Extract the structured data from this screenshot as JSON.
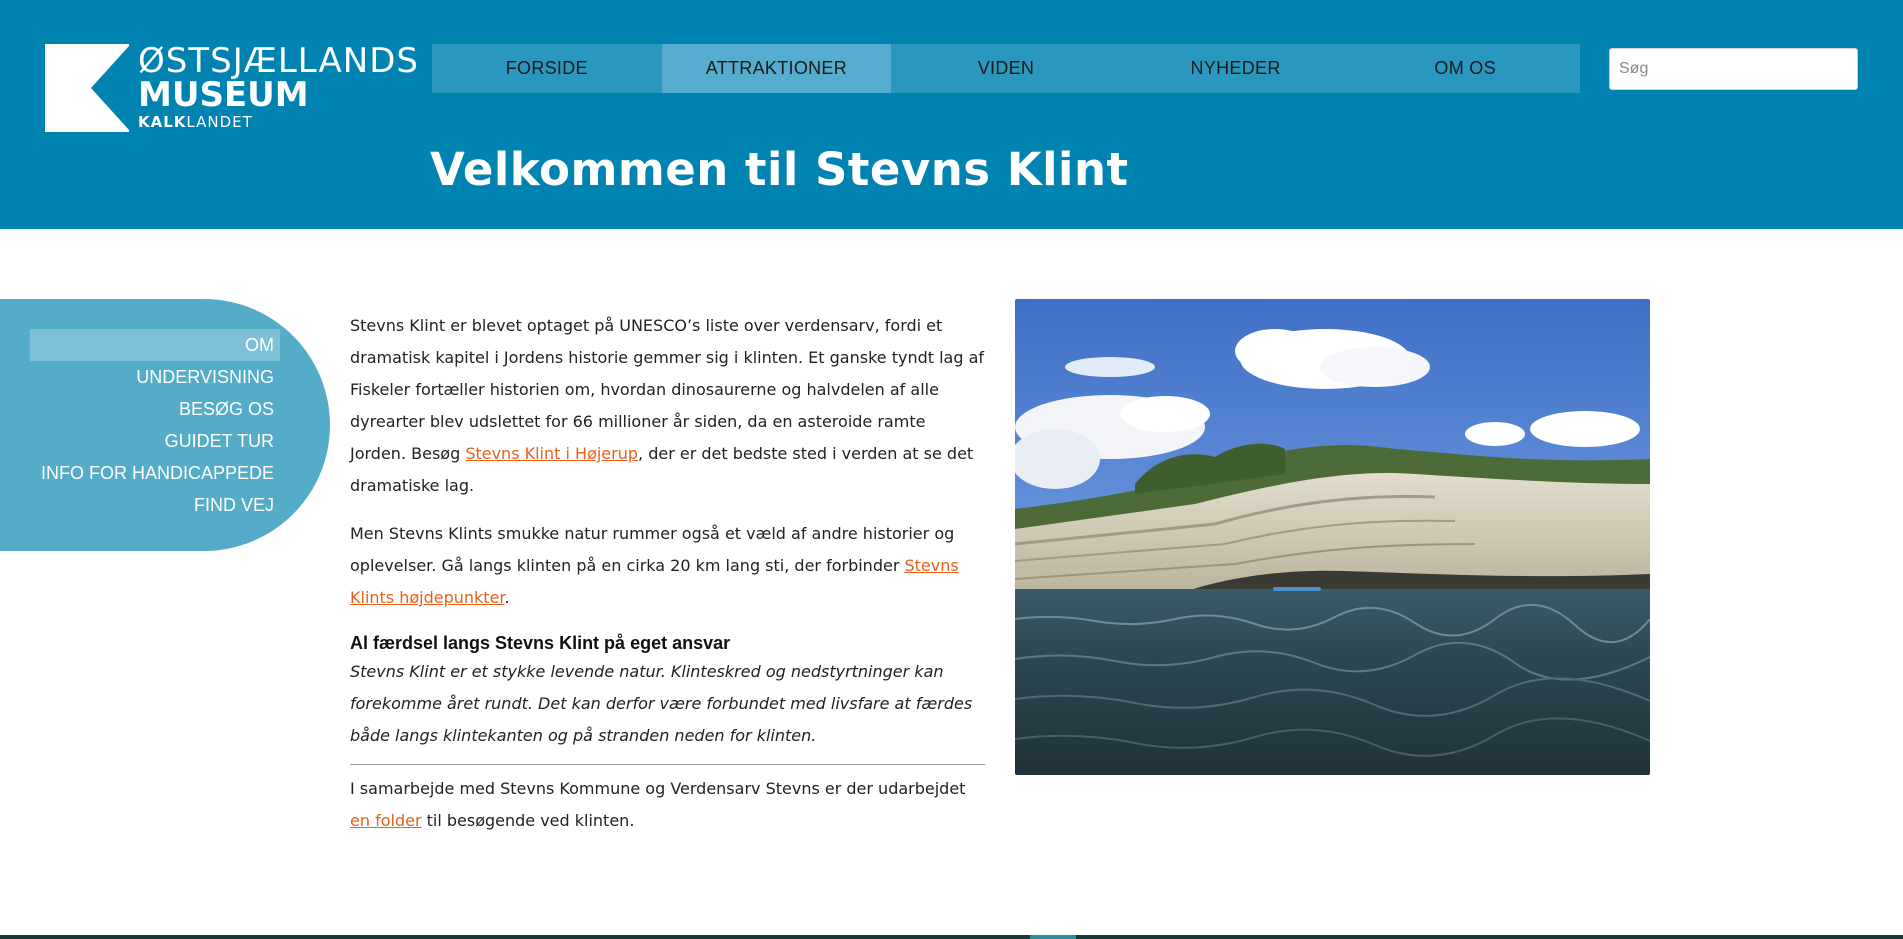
{
  "logo": {
    "line1": "ØSTSJÆLLANDS",
    "line2": "MUSEUM",
    "line3_bold": "KALK",
    "line3_rest": "LANDET",
    "icon": "logo-mark-icon"
  },
  "topnav": {
    "items": [
      {
        "label": "FORSIDE"
      },
      {
        "label": "ATTRAKTIONER"
      },
      {
        "label": "VIDEN"
      },
      {
        "label": "NYHEDER"
      },
      {
        "label": "OM OS"
      }
    ],
    "active": "ATTRAKTIONER"
  },
  "search": {
    "placeholder": "Søg",
    "value": ""
  },
  "page": {
    "title": "Velkommen til Stevns Klint"
  },
  "sidenav": {
    "items": [
      {
        "label": "OM"
      },
      {
        "label": "UNDERVISNING"
      },
      {
        "label": "BESØG OS"
      },
      {
        "label": "GUIDET TUR"
      },
      {
        "label": "INFO FOR HANDICAPPEDE"
      },
      {
        "label": "FIND VEJ"
      }
    ],
    "active": "OM"
  },
  "content": {
    "p1_text": "Stevns Klint er blevet optaget på UNESCO’s liste over verdensarv, fordi et dramatisk kapitel i Jordens historie gemmer sig i klinten. Et ganske tyndt lag af Fiskeler fortæller historien om, hvordan dinosaurerne og halvdelen af alle dyrearter blev udslettet for 66 millioner år siden, da en asteroide ramte Jorden. Besøg ",
    "p1_link": "Stevns Klint i Højerup",
    "p1_after": ", der er det bedste sted i verden at se det dramatiske lag.",
    "p2_text": "Men Stevns Klints smukke natur rummer også et væld af andre historier og oplevelser. Gå langs klinten på en cirka 20 km lang sti, der forbinder ",
    "p2_link": "Stevns Klints højdepunkter",
    "p2_after": ".",
    "warning_heading": "Al færdsel langs Stevns Klint på eget ansvar",
    "warning_text": "Stevns Klint er et stykke levende natur. Klinteskred og nedstyrtninger kan forekomme året rundt. Det kan derfor være forbundet med livsfare at færdes både langs klintekanten og på stranden neden for klinten.",
    "p3_text": "I samarbejde med Stevns Kommune og Verdensarv Stevns er der udarbejdet ",
    "p3_link": "en folder",
    "p3_after": " til besøgende ved klinten."
  },
  "colors": {
    "header_bg": "#0083b0",
    "nav_bg": "#2a97be",
    "nav_active": "#55acce",
    "sidenav_bg": "#55acc8",
    "link": "#e8601c"
  }
}
